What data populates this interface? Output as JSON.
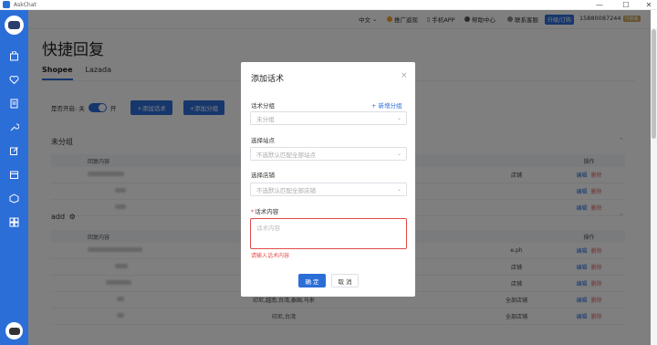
{
  "window": {
    "title": "AskChat",
    "minimize": "—",
    "maximize": "☐",
    "close": "✕"
  },
  "topbar": {
    "language": "中文",
    "promo": "推广返现",
    "mobile_app": "手机APP",
    "help": "帮助中心",
    "support": "联系客服",
    "upgrade": "升级/订购",
    "phone": "15880087244",
    "vip": "付费版"
  },
  "page": {
    "title": "快捷回复",
    "tabs": [
      {
        "label": "Shopee",
        "active": true
      },
      {
        "label": "Lazada",
        "active": false
      }
    ],
    "toggle_label": "是否开启: 关",
    "toggle_on": "开",
    "toggle_state": true,
    "add_script_button": "+添加话术",
    "add_group_button": "+添加分组"
  },
  "groups": [
    {
      "name": "未分组",
      "header": [
        "回复内容",
        "",
        "",
        "",
        "操作"
      ],
      "rows": [
        {
          "col4": "店铺"
        },
        {
          "col4": ""
        },
        {
          "col4": ""
        }
      ]
    },
    {
      "name": "add",
      "header": [
        "回复内容",
        "",
        "",
        "",
        "操作"
      ],
      "rows": [
        {
          "col4": "e.ph",
          "col1_visible": "······"
        },
        {
          "col4": "店铺"
        },
        {
          "col4": "店铺"
        },
        {
          "col2": "印尼,越南,台湾,泰国,马来",
          "col4": "全部店铺"
        },
        {
          "col2": "印尼,台湾",
          "col4": "全部店铺"
        }
      ]
    }
  ],
  "ops": {
    "edit": "编辑",
    "delete": "删除"
  },
  "modal": {
    "title": "添加话术",
    "close": "×",
    "group_label": "话术分组",
    "new_group_link": "+ 新增分组",
    "group_placeholder": "未分组",
    "site_label": "选择站点",
    "site_placeholder": "不选默认匹配全部站点",
    "shop_label": "选择店铺",
    "shop_placeholder": "不选默认匹配全部店铺",
    "content_label": "话术内容",
    "content_placeholder": "话术内容",
    "content_error": "请输入话术内容",
    "ok": "确 定",
    "cancel": "取 消"
  },
  "colors": {
    "primary": "#2c6ed8",
    "error": "#e24b4b"
  }
}
